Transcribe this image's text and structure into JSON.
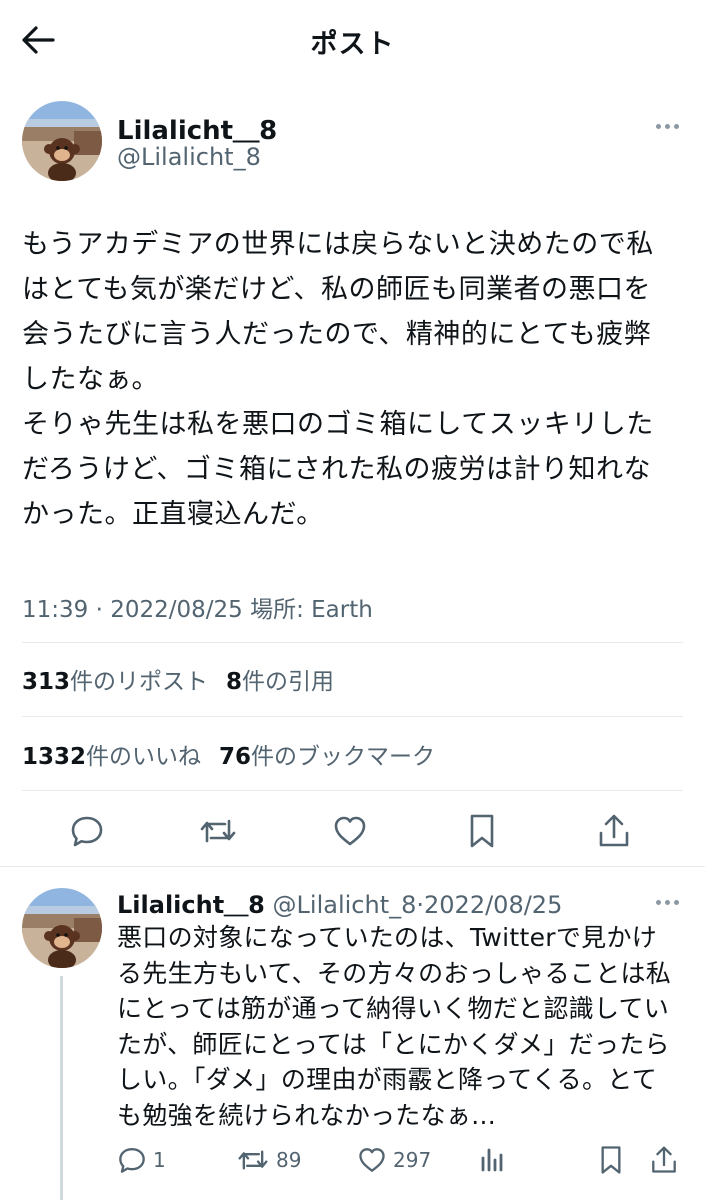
{
  "header": {
    "title": "ポスト",
    "back_icon": "arrow-left-icon"
  },
  "tweet": {
    "author_name": "Lilalicht＿8",
    "author_handle": "@Lilalicht_8",
    "body_lines": [
      "もうアカデミアの世界には戻らないと決めたので私",
      "はとても気が楽だけど、私の師匠も同業者の悪口を",
      "会うたびに言う人だったので、精神的にとても疲弊",
      "したなぁ。",
      "そりゃ先生は私を悪口のゴミ箱にしてスッキリした",
      "だろうけど、ゴミ箱にされた私の疲労は計り知れな",
      "かった。正直寝込んだ。"
    ],
    "time": "11:39 · 2022/08/25 場所: Earth",
    "reposts_count": "313",
    "reposts_label": "件のリポスト",
    "quotes_count": "8",
    "quotes_label": "件の引用",
    "likes_count": "1332",
    "likes_label": "件のいいね",
    "bookmarks_count": "76",
    "bookmarks_label": "件のブックマーク"
  },
  "reply": {
    "author_name": "Lilalicht＿8",
    "author_handle": "@Lilalicht_8",
    "separator": "·",
    "date": "2022/08/25",
    "body_lines": [
      "悪口の対象になっていたのは、Twitterで見かけ",
      "る先生方もいて、その方々のおっしゃることは私",
      "にとっては筋が通って納得いく物だと認識してい",
      "たが、師匠にとっては「とにかくダメ」だったら",
      "しい。「ダメ」の理由が雨霰と降ってくる。とて",
      "も勉強を続けられなかったなぁ..."
    ],
    "reply_count": "1",
    "repost_count": "89",
    "like_count": "297"
  },
  "colors": {
    "text": "#0f1419",
    "secondary": "#536471",
    "divider": "#e6ecf0"
  }
}
